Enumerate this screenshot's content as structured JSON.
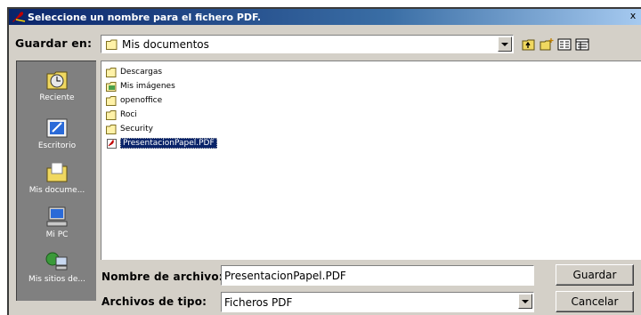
{
  "window": {
    "title": "Seleccione un nombre para el fichero PDF.",
    "close_glyph": "x"
  },
  "lookin": {
    "label": "Guardar en:",
    "value": "Mis documentos"
  },
  "toolbar": {
    "icons": [
      "up-folder-icon",
      "new-folder-icon",
      "list-view-icon",
      "details-view-icon"
    ]
  },
  "places": [
    {
      "label": "Reciente",
      "icon": "recent-icon"
    },
    {
      "label": "Escritorio",
      "icon": "desktop-icon"
    },
    {
      "label": "Mis docume...",
      "icon": "my-documents-icon"
    },
    {
      "label": "Mi PC",
      "icon": "my-computer-icon"
    },
    {
      "label": "Mis sitios de...",
      "icon": "network-places-icon"
    }
  ],
  "files": [
    {
      "name": "Descargas",
      "type": "folder"
    },
    {
      "name": "Mis imágenes",
      "type": "pictures-folder"
    },
    {
      "name": "openoffice",
      "type": "folder"
    },
    {
      "name": "Roci",
      "type": "folder"
    },
    {
      "name": "Security",
      "type": "folder"
    },
    {
      "name": "PresentacionPapel.PDF",
      "type": "pdf",
      "selected": true
    }
  ],
  "filename": {
    "label": "Nombre de archivo:",
    "value": "PresentacionPapel.PDF"
  },
  "filetype": {
    "label": "Archivos de tipo:",
    "value": "Ficheros PDF"
  },
  "buttons": {
    "save": "Guardar",
    "cancel": "Cancelar"
  },
  "colors": {
    "selection": "#0a246a",
    "face": "#d4d0c8",
    "places_bg": "#808080"
  }
}
